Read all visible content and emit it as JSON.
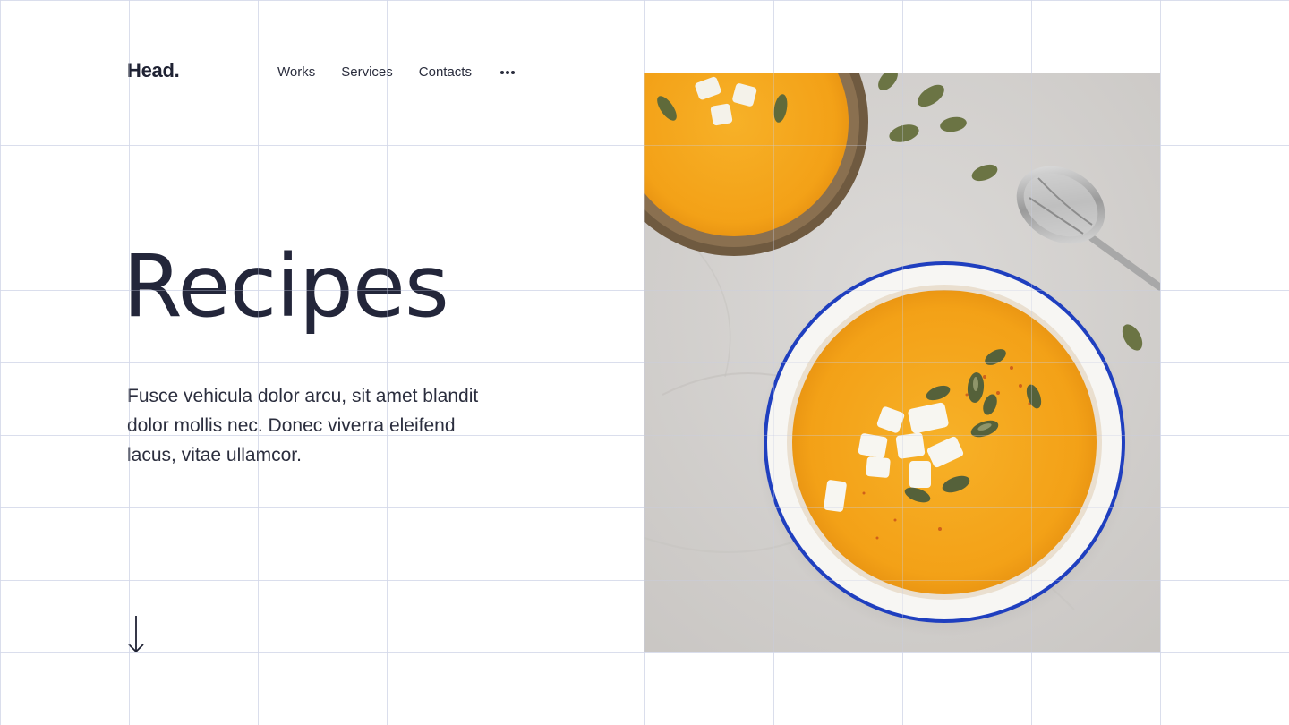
{
  "header": {
    "logo": "Head.",
    "nav": [
      "Works",
      "Services",
      "Contacts"
    ],
    "more_icon": "more-horizontal-icon"
  },
  "hero": {
    "title": "Recipes",
    "description": "Fusce vehicula dolor arcu, sit amet blandit dolor mollis nec. Donec viverra eleifend lacus, vitae ullamcor.",
    "scroll_icon": "arrow-down-icon",
    "image": "pumpkin-soup-photo"
  },
  "colors": {
    "text": "#22263a",
    "grid": "#e3e7f1",
    "soup": "#f5a71c",
    "bowl_rim": "#1f3fbf",
    "marble": "#d8d6d4"
  }
}
